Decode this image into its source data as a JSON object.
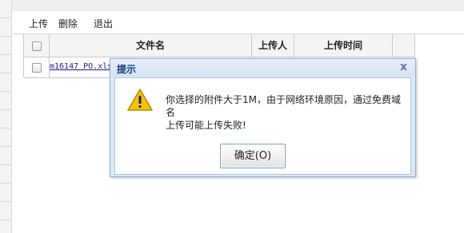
{
  "toolbar": {
    "upload": "上传",
    "delete": "删除",
    "exit": "退出"
  },
  "table": {
    "columns": [
      "文件名",
      "上传人",
      "上传时间"
    ],
    "rows": [
      {
        "file": "m16147 PO.xls"
      }
    ]
  },
  "dialog": {
    "title": "提示",
    "close": "x",
    "message_line1": "你选择的附件大于1M，由于网络环境原因，通过免费域名",
    "message_line2": "上传可能上传失败!",
    "ok": "确定(O)"
  },
  "colors": {
    "dialog_title_text": "#0f3c78",
    "dialog_border": "#8eb2d6",
    "link": "#1a1a8c",
    "warning": "#f5c400"
  },
  "icons": {
    "warning": "warning-icon",
    "close": "close-icon",
    "checkbox": "checkbox"
  }
}
